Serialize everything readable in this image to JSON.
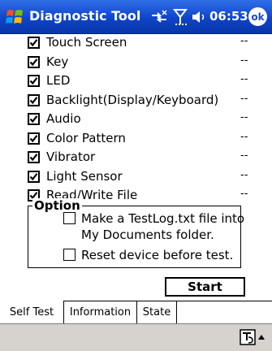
{
  "titlebar": {
    "app_title": "Diagnostic Tool",
    "time": "06:53",
    "ok_label": "ok",
    "icons": [
      "windows-start-icon",
      "connectivity-icon",
      "signal-icon",
      "speaker-icon"
    ]
  },
  "tests": [
    {
      "label": "Touch Screen",
      "checked": true,
      "status": "--"
    },
    {
      "label": "Key",
      "checked": true,
      "status": "--"
    },
    {
      "label": "LED",
      "checked": true,
      "status": "--"
    },
    {
      "label": "Backlight(Display/Keyboard)",
      "checked": true,
      "status": "--"
    },
    {
      "label": "Audio",
      "checked": true,
      "status": "--"
    },
    {
      "label": "Color Pattern",
      "checked": true,
      "status": "--"
    },
    {
      "label": "Vibrator",
      "checked": true,
      "status": "--"
    },
    {
      "label": "Light Sensor",
      "checked": true,
      "status": "--"
    },
    {
      "label": "Read/Write File",
      "checked": true,
      "status": "--"
    }
  ],
  "option": {
    "legend": "Option",
    "testlog_line1": "Make a TestLog.txt file into",
    "testlog_line2": "My Documents folder.",
    "testlog_checked": false,
    "reset_label": "Reset device before test.",
    "reset_checked": false
  },
  "start_button": "Start",
  "tabs": [
    {
      "label": "Self Test",
      "active": true
    },
    {
      "label": "Information",
      "active": false
    },
    {
      "label": "State",
      "active": false
    }
  ],
  "colors": {
    "titlebar": "#1d48c8",
    "command_bar": "#d6d3ce"
  }
}
